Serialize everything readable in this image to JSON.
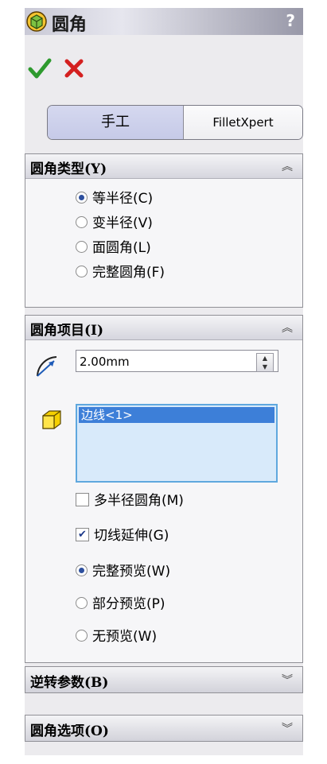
{
  "title": "圆角",
  "help": "?",
  "actions": {
    "ok_icon": "check-icon",
    "cancel_icon": "x-icon"
  },
  "tabs": [
    {
      "label": "手工",
      "active": true
    },
    {
      "label": "FilletXpert",
      "active": false
    }
  ],
  "fillet_type": {
    "header": "圆角类型(Y)",
    "options": [
      {
        "label": "等半径(C)",
        "selected": true
      },
      {
        "label": "变半径(V)",
        "selected": false
      },
      {
        "label": "面圆角(L)",
        "selected": false
      },
      {
        "label": "完整圆角(F)",
        "selected": false
      }
    ]
  },
  "fillet_items": {
    "header": "圆角项目(I)",
    "radius_value": "2.00mm",
    "selection": [
      "边线<1>"
    ],
    "multi_radius": {
      "label": "多半径圆角(M)",
      "checked": false
    },
    "tangent": {
      "label": "切线延伸(G)",
      "checked": true
    },
    "preview_options": [
      {
        "label": "完整预览(W)",
        "selected": true
      },
      {
        "label": "部分预览(P)",
        "selected": false
      },
      {
        "label": "无预览(W)",
        "selected": false
      }
    ]
  },
  "setback": {
    "header": "逆转参数(B)"
  },
  "fillet_options": {
    "header": "圆角选项(O)"
  },
  "colors": {
    "ok": "#2e9a2e",
    "cancel": "#d42020",
    "selection": "#3d7fd8",
    "active_tab": "#c6cae8"
  }
}
